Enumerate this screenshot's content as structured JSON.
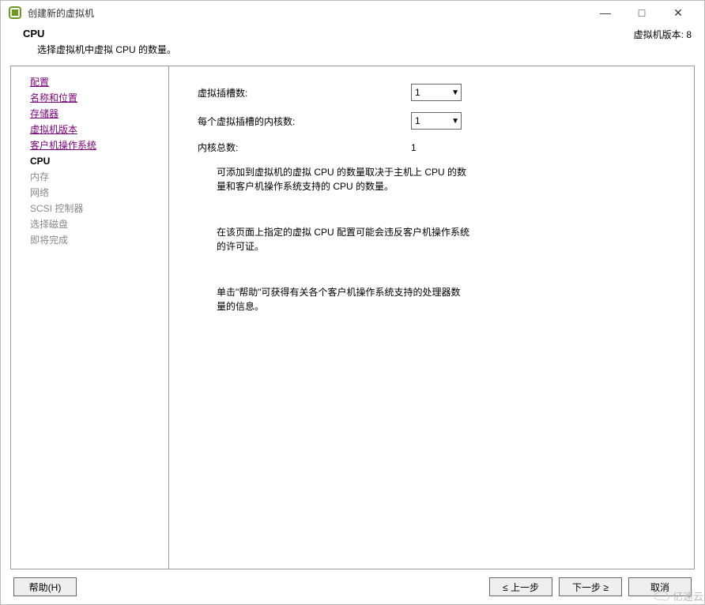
{
  "titlebar": {
    "title": "创建新的虚拟机"
  },
  "header": {
    "title": "CPU",
    "subtitle": "选择虚拟机中虚拟 CPU 的数量。",
    "version_label": "虚拟机版本:",
    "version_value": "8"
  },
  "sidebar": {
    "items": [
      {
        "label": "配置",
        "state": "visited"
      },
      {
        "label": "名称和位置",
        "state": "visited"
      },
      {
        "label": "存储器",
        "state": "visited"
      },
      {
        "label": "虚拟机版本",
        "state": "visited"
      },
      {
        "label": "客户机操作系统",
        "state": "visited"
      },
      {
        "label": "CPU",
        "state": "current"
      },
      {
        "label": "内存",
        "state": "disabled"
      },
      {
        "label": "网络",
        "state": "disabled"
      },
      {
        "label": "SCSI 控制器",
        "state": "disabled"
      },
      {
        "label": "选择磁盘",
        "state": "disabled"
      },
      {
        "label": "即将完成",
        "state": "disabled"
      }
    ]
  },
  "content": {
    "socket_label": "虚拟插槽数:",
    "socket_value": "1",
    "cores_label": "每个虚拟插槽的内核数:",
    "cores_value": "1",
    "total_label": "内核总数:",
    "total_value": "1",
    "info1": "可添加到虚拟机的虚拟 CPU 的数量取决于主机上 CPU 的数量和客户机操作系统支持的 CPU 的数量。",
    "info2": "在该页面上指定的虚拟 CPU 配置可能会违反客户机操作系统的许可证。",
    "info3": "单击\"帮助\"可获得有关各个客户机操作系统支持的处理器数量的信息。"
  },
  "footer": {
    "help": "帮助(H)",
    "back": "≤ 上一步",
    "next": "下一步 ≥",
    "cancel": "取消"
  },
  "watermark": "亿速云"
}
